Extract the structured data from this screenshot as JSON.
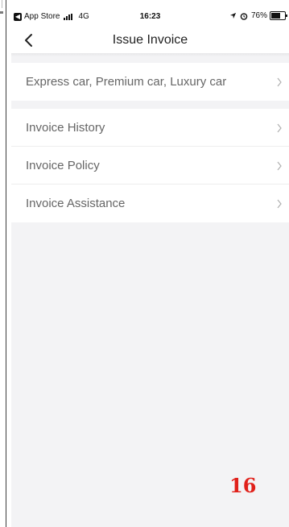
{
  "status_bar": {
    "back_app": "App Store",
    "network": "4G",
    "time": "16:23",
    "battery": "76%"
  },
  "header": {
    "title": "Issue Invoice"
  },
  "menu": {
    "group1": [
      {
        "label": "Express car, Premium car, Luxury car"
      }
    ],
    "group2": [
      {
        "label": "Invoice History"
      },
      {
        "label": "Invoice Policy"
      },
      {
        "label": "Invoice Assistance"
      }
    ]
  },
  "overlay": {
    "page_number": "16"
  },
  "colors": {
    "background": "#f3f3f5",
    "label_text": "#666666",
    "page_number": "#e0201a"
  }
}
